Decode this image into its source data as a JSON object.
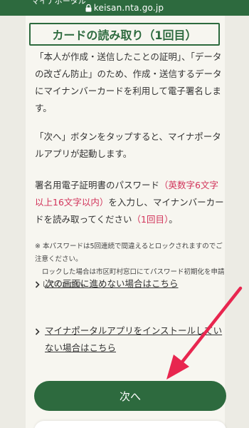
{
  "browser": {
    "url": "keisan.nta.go.jp",
    "app_partial": "マイナポータル"
  },
  "page": {
    "title": "カードの読み取り（1回目）",
    "para1": "「本人が作成・送信したことの証明」、「データの改ざん防止」のため、作成・送信するデータにマイナンバーカードを利用して電子署名します。",
    "para2": "「次へ」ボタンをタップすると、マイナポータルアプリが起動します。",
    "para3_a": "署名用電子証明書のパスワード",
    "para3_b": "（英数字6文字以上16文字以内）",
    "para3_c": "を入力し、マイナンバーカードを読み取ってください",
    "para3_d": "（1回目）",
    "para3_e": "。",
    "note_1": "※ 本パスワードは5回連続で間違えるとロックされますのでご注意ください。",
    "note_2": "ロックした場合は市区町村窓口にてパスワード初期化を申請してください。",
    "link1": "次の画面に進めない場合はこちら",
    "link2": "マイナポータルアプリをインストールしていない場合はこちら",
    "next_button": "次へ"
  },
  "colors": {
    "brand_green": "#2d6a3e",
    "emphasis_red": "#d2335a",
    "annotation_arrow": "#e8264f"
  },
  "icons": [
    "lock-icon",
    "chevron-right-icon",
    "annotation-arrow-icon"
  ]
}
